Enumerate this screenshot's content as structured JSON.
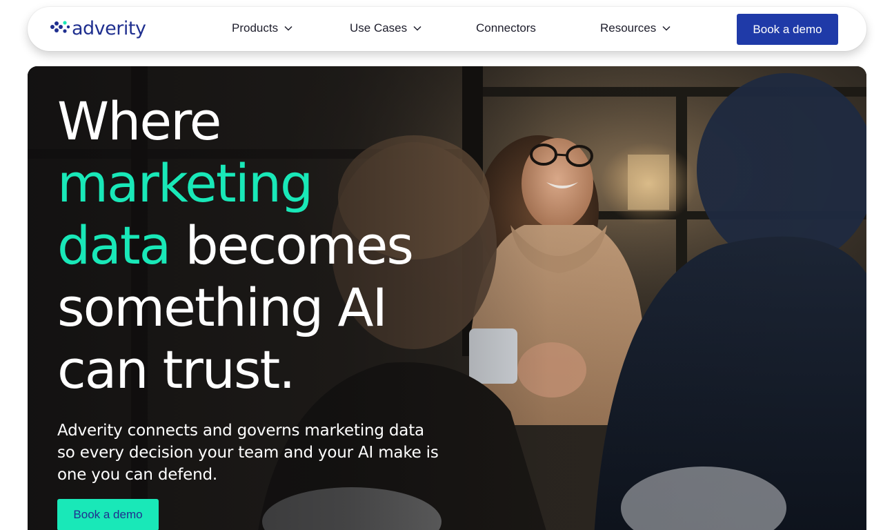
{
  "brand": {
    "name": "adverity",
    "logo_icon": "adverity-logo-mark",
    "primary_color": "#1f3aa8",
    "accent_color": "#19e8b8"
  },
  "nav": {
    "items": [
      {
        "label": "Products",
        "has_dropdown": true
      },
      {
        "label": "Use Cases",
        "has_dropdown": true
      },
      {
        "label": "Connectors",
        "has_dropdown": false
      },
      {
        "label": "Resources",
        "has_dropdown": true
      }
    ],
    "cta_label": "Book a demo"
  },
  "hero": {
    "headline": {
      "line1": "Where",
      "line2": "marketing",
      "line3_accent": "data",
      "line3_rest": " becomes",
      "line4": "something AI",
      "line5": "can trust."
    },
    "subtext": "Adverity connects and governs marketing data so every decision your team and your AI make is one you can defend.",
    "cta_label": "Book a demo"
  }
}
